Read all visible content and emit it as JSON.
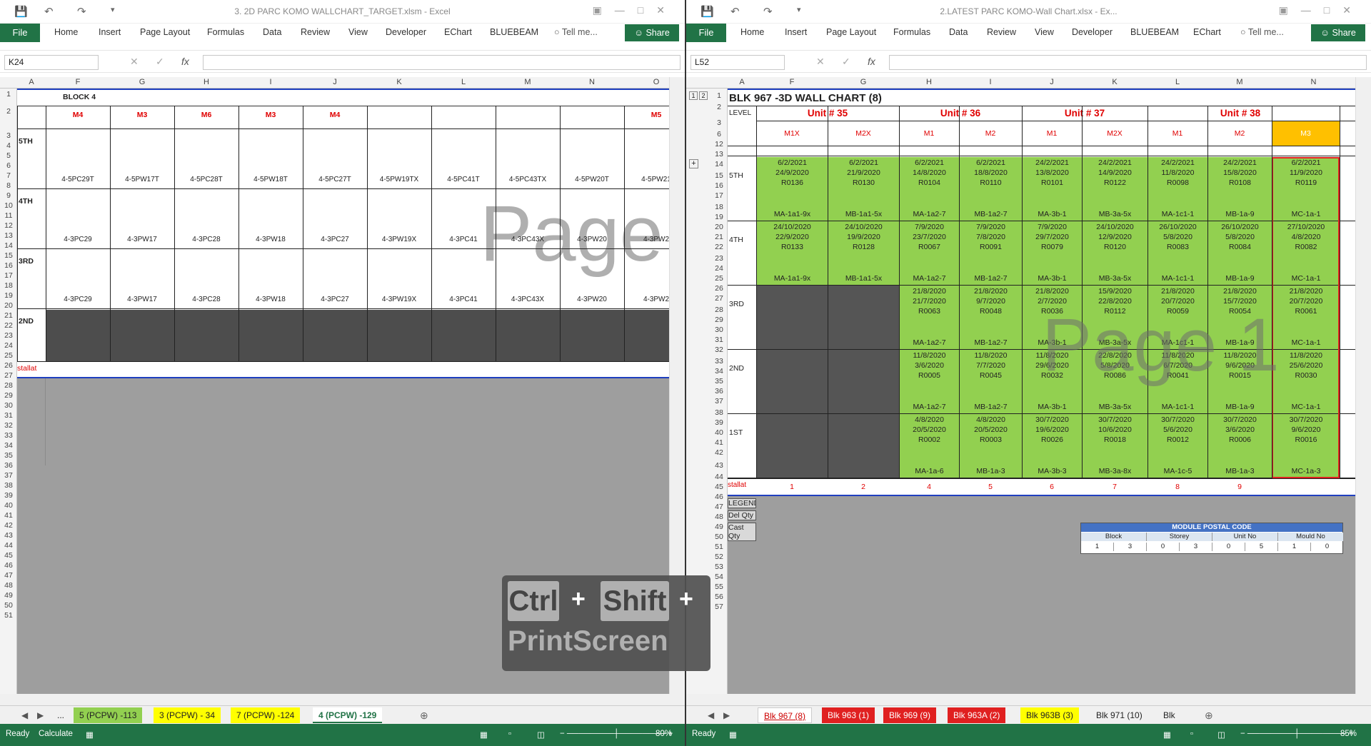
{
  "left": {
    "title": "3. 2D PARC KOMO WALLCHART_TARGET.xlsm - Excel",
    "ribbon_tabs": [
      "File",
      "Home",
      "Insert",
      "Page Layout",
      "Formulas",
      "Data",
      "Review",
      "View",
      "Developer",
      "EChart",
      "BLUEBEAM",
      "Tell me..."
    ],
    "share": "Share",
    "namebox": "K24",
    "cols": [
      "A",
      "F",
      "G",
      "H",
      "I",
      "J",
      "K",
      "L",
      "M",
      "N",
      "O"
    ],
    "rows": [
      "1",
      "2",
      "3",
      "4",
      "5",
      "6",
      "7",
      "8",
      "9",
      "10",
      "11",
      "12",
      "13",
      "14",
      "15",
      "16",
      "17",
      "18",
      "19",
      "20",
      "21",
      "22",
      "23",
      "24",
      "25",
      "26",
      "27",
      "28",
      "29",
      "30",
      "31",
      "32",
      "33",
      "34",
      "35",
      "36",
      "37",
      "38",
      "39",
      "40",
      "41",
      "42",
      "43",
      "44",
      "45",
      "46",
      "47",
      "48",
      "49",
      "50",
      "51"
    ],
    "block": "BLOCK 4",
    "moulds": [
      "M4",
      "M3",
      "M6",
      "M3",
      "M4",
      "",
      "",
      "",
      "M5"
    ],
    "levels": [
      "5TH",
      "4TH",
      "3RD",
      "2ND"
    ],
    "codes5": [
      "4-5PC29T",
      "4-5PW17T",
      "4-5PC28T",
      "4-5PW18T",
      "4-5PC27T",
      "4-5PW19TX",
      "4-5PC41T",
      "4-5PC43TX",
      "4-5PW20T",
      "4-5PW21"
    ],
    "codes4": [
      "4-3PC29",
      "4-3PW17",
      "4-3PC28",
      "4-3PW18",
      "4-3PC27",
      "4-3PW19X",
      "4-3PC41",
      "4-3PC43X",
      "4-3PW20",
      "4-3PW2"
    ],
    "codes3": [
      "4-3PC29",
      "4-3PW17",
      "4-3PC28",
      "4-3PW18",
      "4-3PC27",
      "4-3PW19X",
      "4-3PC41",
      "4-3PC43X",
      "4-3PW20",
      "4-3PW2"
    ],
    "install_label": "stallat",
    "watermark": "Page",
    "tabs": [
      "...",
      "5 (PCPW) -113",
      "3 (PCPW) - 34",
      "7 (PCPW) -124",
      "4 (PCPW) -129"
    ],
    "status_ready": "Ready",
    "status_calc": "Calculate",
    "zoom": "80%"
  },
  "right": {
    "title": "2.LATEST PARC KOMO-Wall Chart.xlsx - Ex...",
    "ribbon_tabs": [
      "File",
      "Home",
      "Insert",
      "Page Layout",
      "Formulas",
      "Data",
      "Review",
      "View",
      "Developer",
      "BLUEBEAM",
      "EChart",
      "Tell me..."
    ],
    "share": "Share",
    "namebox": "L52",
    "cols": [
      "A",
      "F",
      "G",
      "H",
      "I",
      "J",
      "K",
      "L",
      "M",
      "N"
    ],
    "rows": [
      "1",
      "2",
      "3",
      "6",
      "12",
      "13",
      "14",
      "15",
      "16",
      "17",
      "18",
      "19",
      "20",
      "21",
      "22",
      "23",
      "24",
      "25",
      "26",
      "27",
      "28",
      "29",
      "30",
      "31",
      "32",
      "33",
      "34",
      "35",
      "36",
      "37",
      "38",
      "39",
      "40",
      "41",
      "42",
      "43",
      "44",
      "45",
      "46",
      "47",
      "48",
      "49",
      "50",
      "51",
      "52",
      "53",
      "54",
      "55",
      "56",
      "57"
    ],
    "chart_title": "BLK 967 -3D WALL CHART (8)",
    "level_label": "LEVEL",
    "units": [
      "Unit # 35",
      "Unit # 36",
      "Unit # 37",
      "Unit # 38"
    ],
    "moulds": [
      "M1X",
      "M2X",
      "M1",
      "M2",
      "M1",
      "M2X",
      "M1",
      "M2",
      "M3"
    ],
    "levels": [
      "5TH",
      "4TH",
      "3RD",
      "2ND",
      "1ST"
    ],
    "data": [
      [
        [
          "6/2/2021",
          "24/9/2020",
          "R0136",
          "MA-1a1-9x"
        ],
        [
          "6/2/2021",
          "21/9/2020",
          "R0130",
          "MB-1a1-5x"
        ],
        [
          "6/2/2021",
          "14/8/2020",
          "R0104",
          "MA-1a2-7"
        ],
        [
          "6/2/2021",
          "18/8/2020",
          "R0110",
          "MB-1a2-7"
        ],
        [
          "24/2/2021",
          "13/8/2020",
          "R0101",
          "MA-3b-1"
        ],
        [
          "24/2/2021",
          "14/9/2020",
          "R0122",
          "MB-3a-5x"
        ],
        [
          "24/2/2021",
          "11/8/2020",
          "R0098",
          "MA-1c1-1"
        ],
        [
          "24/2/2021",
          "15/8/2020",
          "R0108",
          "MB-1a-9"
        ],
        [
          "6/2/2021",
          "11/9/2020",
          "R0119",
          "MC-1a-1"
        ]
      ],
      [
        [
          "24/10/2020",
          "22/9/2020",
          "R0133",
          "MA-1a1-9x"
        ],
        [
          "24/10/2020",
          "19/9/2020",
          "R0128",
          "MB-1a1-5x"
        ],
        [
          "7/9/2020",
          "23/7/2020",
          "R0067",
          "MA-1a2-7"
        ],
        [
          "7/9/2020",
          "7/8/2020",
          "R0091",
          "MB-1a2-7"
        ],
        [
          "7/9/2020",
          "29/7/2020",
          "R0079",
          "MA-3b-1"
        ],
        [
          "24/10/2020",
          "12/9/2020",
          "R0120",
          "MB-3a-5x"
        ],
        [
          "26/10/2020",
          "5/8/2020",
          "R0083",
          "MA-1c1-1"
        ],
        [
          "26/10/2020",
          "5/8/2020",
          "R0084",
          "MB-1a-9"
        ],
        [
          "27/10/2020",
          "4/8/2020",
          "R0082",
          "MC-1a-1"
        ]
      ],
      [
        null,
        null,
        [
          "21/8/2020",
          "21/7/2020",
          "R0063",
          "MA-1a2-7"
        ],
        [
          "21/8/2020",
          "9/7/2020",
          "R0048",
          "MB-1a2-7"
        ],
        [
          "21/8/2020",
          "2/7/2020",
          "R0036",
          "MA-3b-1"
        ],
        [
          "15/9/2020",
          "22/8/2020",
          "R0112",
          "MB-3a-5x"
        ],
        [
          "21/8/2020",
          "20/7/2020",
          "R0059",
          "MA-1c1-1"
        ],
        [
          "21/8/2020",
          "15/7/2020",
          "R0054",
          "MB-1a-9"
        ],
        [
          "21/8/2020",
          "20/7/2020",
          "R0061",
          "MC-1a-1"
        ]
      ],
      [
        null,
        null,
        [
          "11/8/2020",
          "3/6/2020",
          "R0005",
          "MA-1a2-7"
        ],
        [
          "11/8/2020",
          "7/7/2020",
          "R0045",
          "MB-1a2-7"
        ],
        [
          "11/8/2020",
          "29/6/2020",
          "R0032",
          "MA-3b-1"
        ],
        [
          "22/8/2020",
          "5/8/2020",
          "R0086",
          "MB-3a-5x"
        ],
        [
          "11/8/2020",
          "6/7/2020",
          "R0041",
          "MA-1c1-1"
        ],
        [
          "11/8/2020",
          "9/6/2020",
          "R0015",
          "MB-1a-9"
        ],
        [
          "11/8/2020",
          "25/6/2020",
          "R0030",
          "MC-1a-1"
        ]
      ],
      [
        null,
        null,
        [
          "4/8/2020",
          "20/5/2020",
          "R0002",
          "MA-1a-6"
        ],
        [
          "4/8/2020",
          "20/5/2020",
          "R0003",
          "MB-1a-3"
        ],
        [
          "30/7/2020",
          "19/6/2020",
          "R0026",
          "MA-3b-3"
        ],
        [
          "30/7/2020",
          "10/6/2020",
          "R0018",
          "MB-3a-8x"
        ],
        [
          "30/7/2020",
          "5/6/2020",
          "R0012",
          "MA-1c-5"
        ],
        [
          "30/7/2020",
          "3/6/2020",
          "R0006",
          "MB-1a-3"
        ],
        [
          "30/7/2020",
          "9/6/2020",
          "R0016",
          "MC-1a-3"
        ]
      ]
    ],
    "install_label": "stallat",
    "install_nums": [
      "1",
      "2",
      "4",
      "5",
      "6",
      "7",
      "8",
      "9",
      ""
    ],
    "legend": [
      "LEGEND",
      "Del Qty",
      "Cast Qty"
    ],
    "postal": {
      "title": "MODULE POSTAL CODE",
      "headers": [
        "Block",
        "Storey",
        "Unit No",
        "Mould No"
      ],
      "digits": [
        "1",
        "3",
        "0",
        "3",
        "0",
        "5",
        "1",
        "0"
      ]
    },
    "watermark": "Page 1",
    "tabs": [
      "Blk 967 (8)",
      "Blk 963 (1)",
      "Blk 969 (9)",
      "Blk 963A (2)",
      "Blk 963B (3)",
      "Blk 971 (10)",
      "Blk"
    ],
    "status_ready": "Ready",
    "zoom": "85%",
    "tab_colors": {
      "active": "#ffffff",
      "red": "#e02020",
      "yellow": "#ffff00",
      "green": "#92d050"
    }
  },
  "overlay": {
    "ctrl": "Ctrl",
    "plus": "+",
    "shift": "Shift",
    "print": "PrintScreen"
  }
}
